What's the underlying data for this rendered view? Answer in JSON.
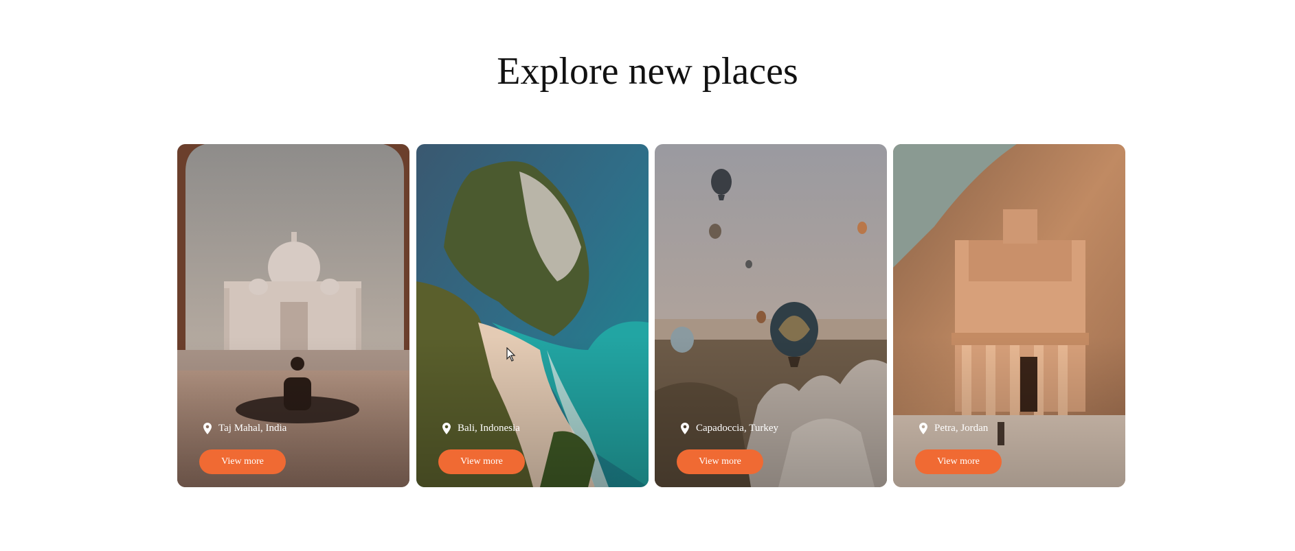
{
  "section": {
    "title": "Explore new places"
  },
  "cards": [
    {
      "location": "Taj Mahal, India",
      "button_label": "View more",
      "icon": "map-pin-icon"
    },
    {
      "location": "Bali, Indonesia",
      "button_label": "View more",
      "icon": "map-pin-icon"
    },
    {
      "location": "Capadoccia, Turkey",
      "button_label": "View more",
      "icon": "map-pin-icon"
    },
    {
      "location": "Petra, Jordan",
      "button_label": "View more",
      "icon": "map-pin-icon"
    }
  ],
  "colors": {
    "accent": "#f06a33",
    "title": "#111111"
  }
}
